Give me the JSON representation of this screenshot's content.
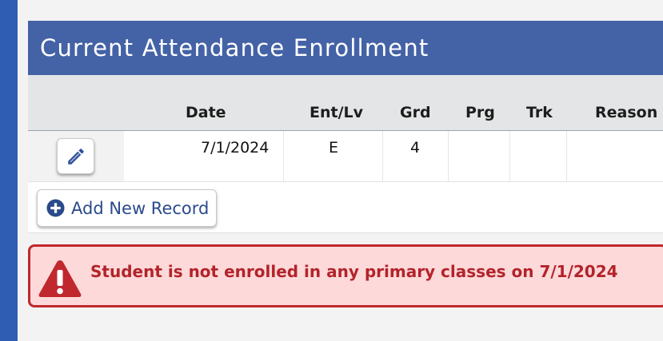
{
  "panel": {
    "title": "Current Attendance Enrollment"
  },
  "table": {
    "columns": [
      "Date",
      "Ent/Lv",
      "Grd",
      "Prg",
      "Trk",
      "Reason"
    ],
    "rows": [
      {
        "date": "7/1/2024",
        "ent_lv": "E",
        "grd": "4",
        "prg": "",
        "trk": "",
        "reason": ""
      }
    ]
  },
  "actions": {
    "add_label": "Add New Record"
  },
  "alert": {
    "message": "Student is not enrolled in any primary classes on 7/1/2024"
  },
  "icons": {
    "edit": "pencil-icon",
    "add": "plus-circle-icon",
    "alert": "warning-triangle-icon"
  },
  "colors": {
    "header": "#4462a6",
    "accent": "#2f5db3",
    "alert_bg": "#fdd9d9",
    "alert_border": "#c0282d",
    "alert_text": "#b3232b"
  }
}
